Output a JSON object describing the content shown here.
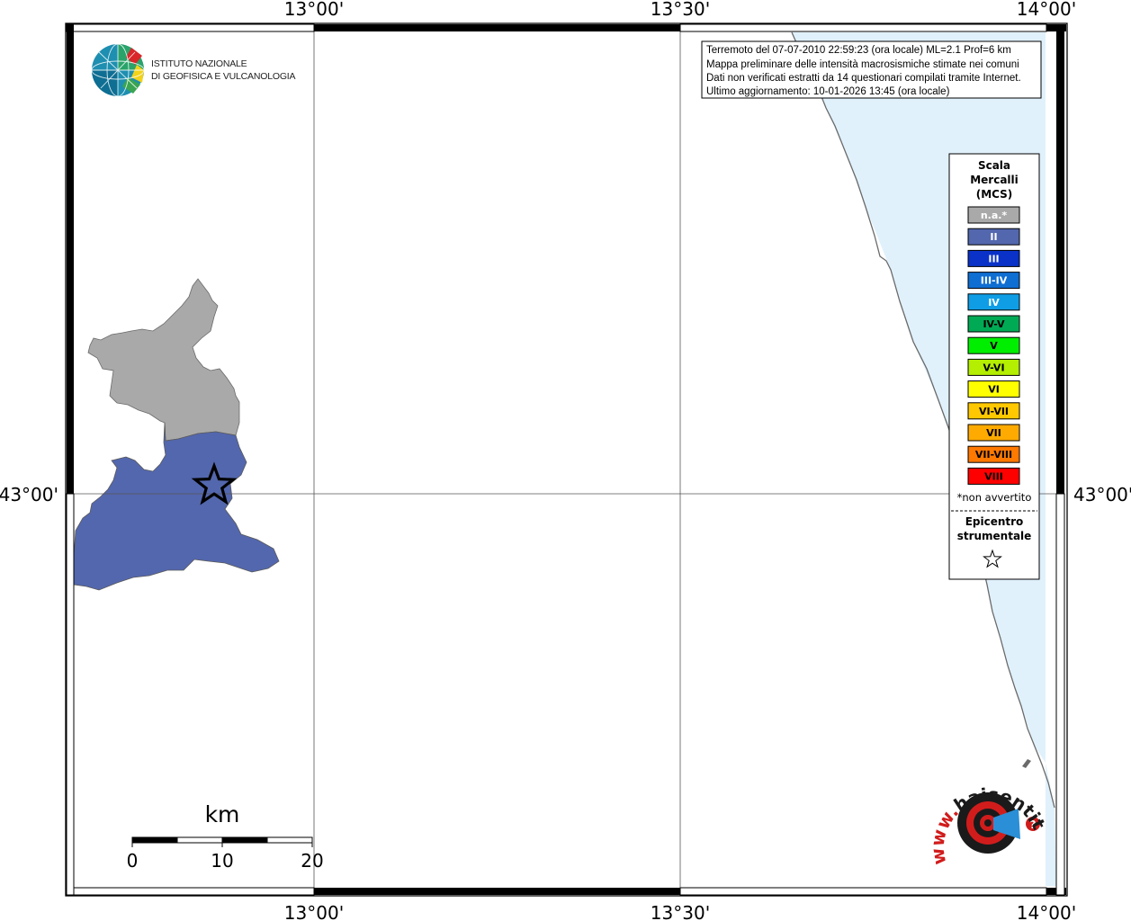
{
  "map": {
    "ticks": {
      "lon_top": [
        "13°00'",
        "13°30'",
        "14°00'"
      ],
      "lon_bottom": [
        "13°00'",
        "13°30'",
        "14°00'"
      ],
      "lat_left": "43°00'",
      "lat_right": "43°00'"
    },
    "colors": {
      "sea": "#e0f1fc",
      "coast": "#6a6a6a",
      "grid": "#555555",
      "na_municipality": "#a9a9a9",
      "ii_municipality": "#5367ae"
    },
    "municipalities": [
      {
        "intensity": "n.a.*"
      },
      {
        "intensity": "II"
      }
    ],
    "epicenter": {
      "lon": "12°50'",
      "lat": "43°00'"
    }
  },
  "logo": {
    "line1": "ISTITUTO NAZIONALE",
    "line2": "DI GEOFISICA E VULCANOLOGIA"
  },
  "info": {
    "lines": [
      "Terremoto del 07-07-2010 22:59:23 (ora locale) ML=2.1 Prof=6 km",
      "Mappa preliminare delle intensità macrosismiche stimate nei comuni",
      "Dati non verificati estratti da 14 questionari compilati tramite Internet.",
      "Ultimo aggiornamento: 10-01-2026 13:45 (ora locale)"
    ]
  },
  "legend": {
    "title": [
      "Scala",
      "Mercalli",
      "(MCS)"
    ],
    "items": [
      {
        "label": "n.a.*",
        "color": "#a9a9a9",
        "text_color": "#ffffff"
      },
      {
        "label": "II",
        "color": "#5367ae",
        "text_color": "#ffffff"
      },
      {
        "label": "III",
        "color": "#0a32c8",
        "text_color": "#ffffff"
      },
      {
        "label": "III-IV",
        "color": "#0f6ed2",
        "text_color": "#ffffff"
      },
      {
        "label": "IV",
        "color": "#0f9ee6",
        "text_color": "#ffffff"
      },
      {
        "label": "IV-V",
        "color": "#00aa55",
        "text_color": "#000000"
      },
      {
        "label": "V",
        "color": "#00ee00",
        "text_color": "#000000"
      },
      {
        "label": "V-VI",
        "color": "#b4ee00",
        "text_color": "#000000"
      },
      {
        "label": "VI",
        "color": "#ffff00",
        "text_color": "#000000"
      },
      {
        "label": "VI-VII",
        "color": "#ffc800",
        "text_color": "#000000"
      },
      {
        "label": "VII",
        "color": "#ffaa00",
        "text_color": "#000000"
      },
      {
        "label": "VII-VIII",
        "color": "#ff7800",
        "text_color": "#000000"
      },
      {
        "label": "VIII",
        "color": "#ff0000",
        "text_color": "#000000"
      }
    ],
    "note": "*non avvertito",
    "epicenter_label": [
      "Epicentro",
      "strumentale"
    ],
    "epicenter_icon": "star-outline-icon"
  },
  "scalebar": {
    "unit": "km",
    "labels": [
      "0",
      "10",
      "20"
    ]
  },
  "badge": {
    "text": "www.haisentitoilterremoto.it",
    "icon": "haisentito-badge-icon"
  }
}
